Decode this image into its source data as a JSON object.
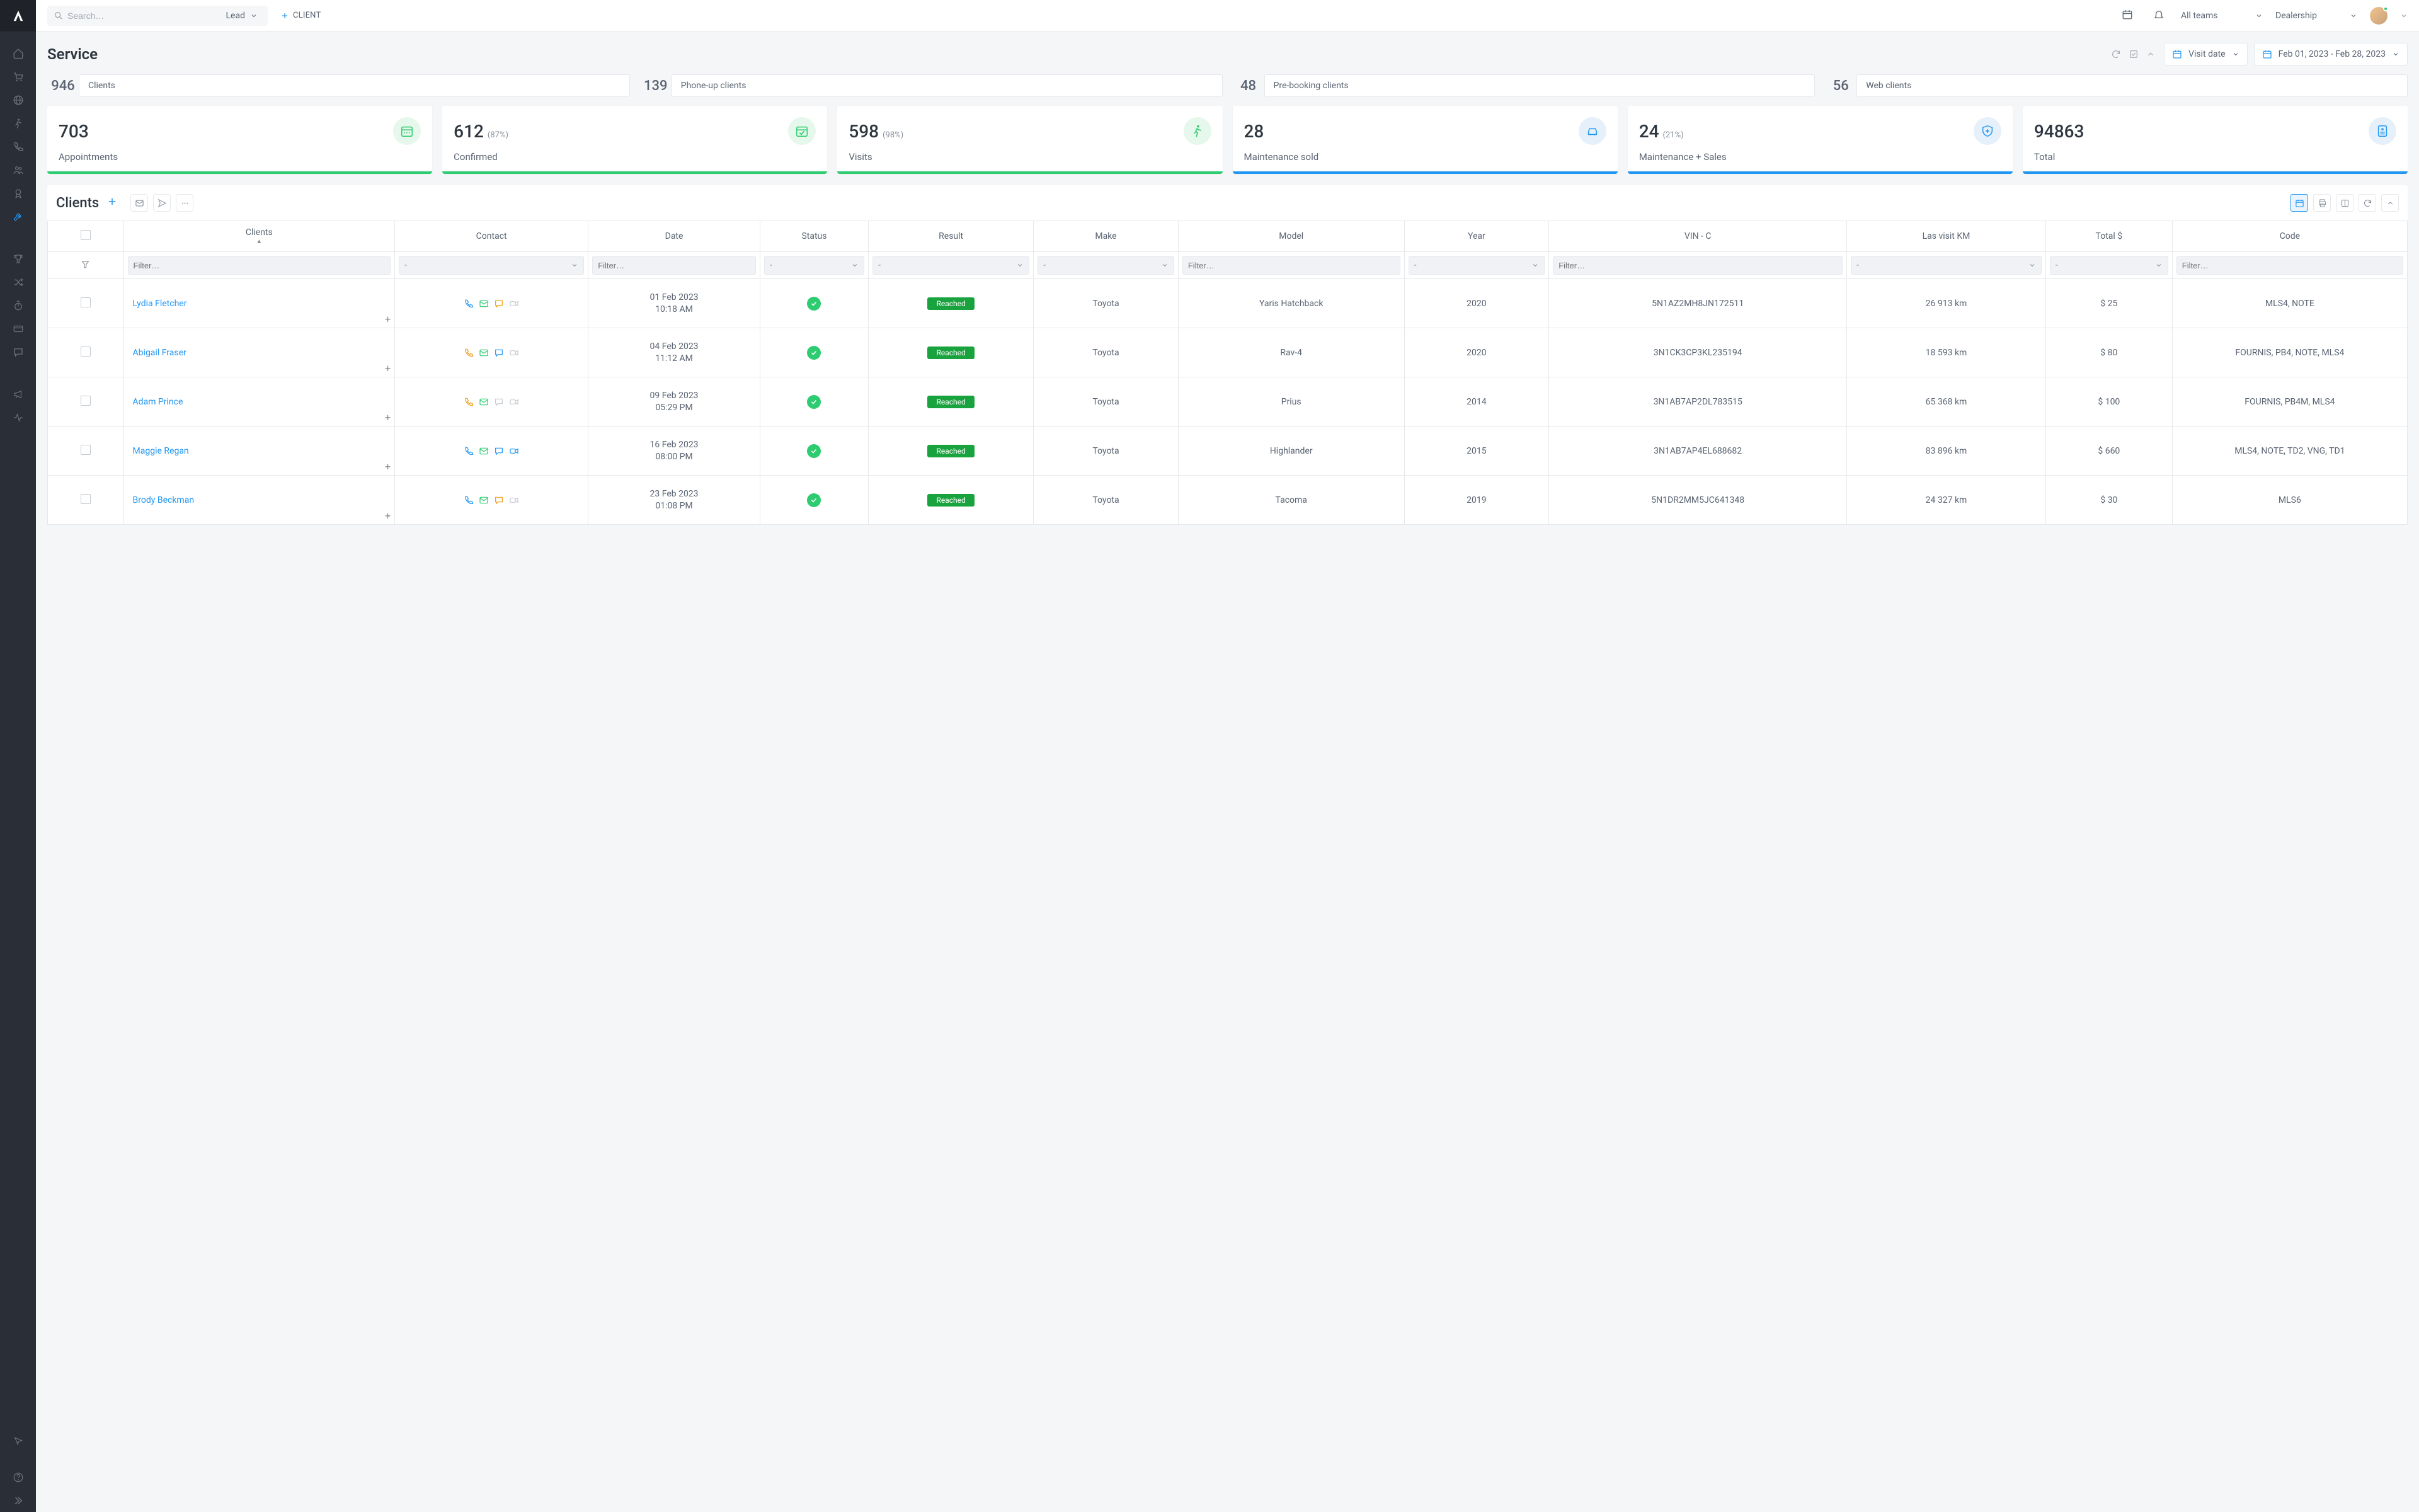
{
  "topbar": {
    "search_placeholder": "Search…",
    "lead_label": "Lead",
    "client_button": "CLIENT",
    "teams_label": "All teams",
    "dealership_label": "Dealership"
  },
  "page": {
    "title": "Service",
    "visit_date_label": "Visit date",
    "date_range": "Feb 01, 2023 - Feb 28, 2023"
  },
  "summaries": [
    {
      "value": "946",
      "label": "Clients"
    },
    {
      "value": "139",
      "label": "Phone-up clients"
    },
    {
      "value": "48",
      "label": "Pre-booking clients"
    },
    {
      "value": "56",
      "label": "Web clients"
    }
  ],
  "kpis": [
    {
      "value": "703",
      "pct": "",
      "label": "Appointments",
      "icon": "calendar-dots",
      "color": "green"
    },
    {
      "value": "612",
      "pct": "(87%)",
      "label": "Confirmed",
      "icon": "calendar-check",
      "color": "green"
    },
    {
      "value": "598",
      "pct": "(98%)",
      "label": "Visits",
      "icon": "walk",
      "color": "green"
    },
    {
      "value": "28",
      "pct": "",
      "label": "Maintenance sold",
      "icon": "car-service",
      "color": "blue"
    },
    {
      "value": "24",
      "pct": "(21%)",
      "label": "Maintenance + Sales",
      "icon": "car-shield",
      "color": "blue"
    },
    {
      "value": "94863",
      "pct": "",
      "label": "Total",
      "icon": "invoice",
      "color": "blue"
    }
  ],
  "clients_section": {
    "title": "Clients"
  },
  "table": {
    "filter_placeholder": "Filter…",
    "dash": "-",
    "headers": {
      "clients": "Clients",
      "contact": "Contact",
      "date": "Date",
      "status": "Status",
      "result": "Result",
      "make": "Make",
      "model": "Model",
      "year": "Year",
      "vin": "VIN - C",
      "km": "Las visit KM",
      "total": "Total $",
      "code": "Code"
    },
    "rows": [
      {
        "name": "Lydia Fletcher",
        "phone": "blue",
        "comment": "orange",
        "video": "grey",
        "date1": "01 Feb 2023",
        "date2": "10:18 AM",
        "result": "Reached",
        "make": "Toyota",
        "model": "Yaris Hatchback",
        "year": "2020",
        "vin": "5N1AZ2MH8JN172511",
        "km": "26 913 km",
        "total": "$ 25",
        "code": "MLS4, NOTE"
      },
      {
        "name": "Abigail Fraser",
        "phone": "orange",
        "comment": "blue",
        "video": "grey",
        "date1": "04 Feb 2023",
        "date2": "11:12 AM",
        "result": "Reached",
        "make": "Toyota",
        "model": "Rav-4",
        "year": "2020",
        "vin": "3N1CK3CP3KL235194",
        "km": "18 593 km",
        "total": "$ 80",
        "code": "FOURNIS, PB4, NOTE, MLS4"
      },
      {
        "name": "Adam Prince",
        "phone": "orange",
        "comment": "grey",
        "video": "grey",
        "date1": "09 Feb 2023",
        "date2": "05:29 PM",
        "result": "Reached",
        "make": "Toyota",
        "model": "Prius",
        "year": "2014",
        "vin": "3N1AB7AP2DL783515",
        "km": "65 368 km",
        "total": "$ 100",
        "code": "FOURNIS, PB4M, MLS4"
      },
      {
        "name": "Maggie Regan",
        "phone": "blue",
        "comment": "blue",
        "video": "blue",
        "date1": "16 Feb 2023",
        "date2": "08:00 PM",
        "result": "Reached",
        "make": "Toyota",
        "model": "Highlander",
        "year": "2015",
        "vin": "3N1AB7AP4EL688682",
        "km": "83 896 km",
        "total": "$ 660",
        "code": "MLS4, NOTE, TD2, VNG, TD1"
      },
      {
        "name": "Brody Beckman",
        "phone": "blue",
        "comment": "orange",
        "video": "grey",
        "date1": "23 Feb 2023",
        "date2": "01:08 PM",
        "result": "Reached",
        "make": "Toyota",
        "model": "Tacoma",
        "year": "2019",
        "vin": "5N1DR2MM5JC641348",
        "km": "24 327 km",
        "total": "$ 30",
        "code": "MLS6"
      }
    ]
  }
}
